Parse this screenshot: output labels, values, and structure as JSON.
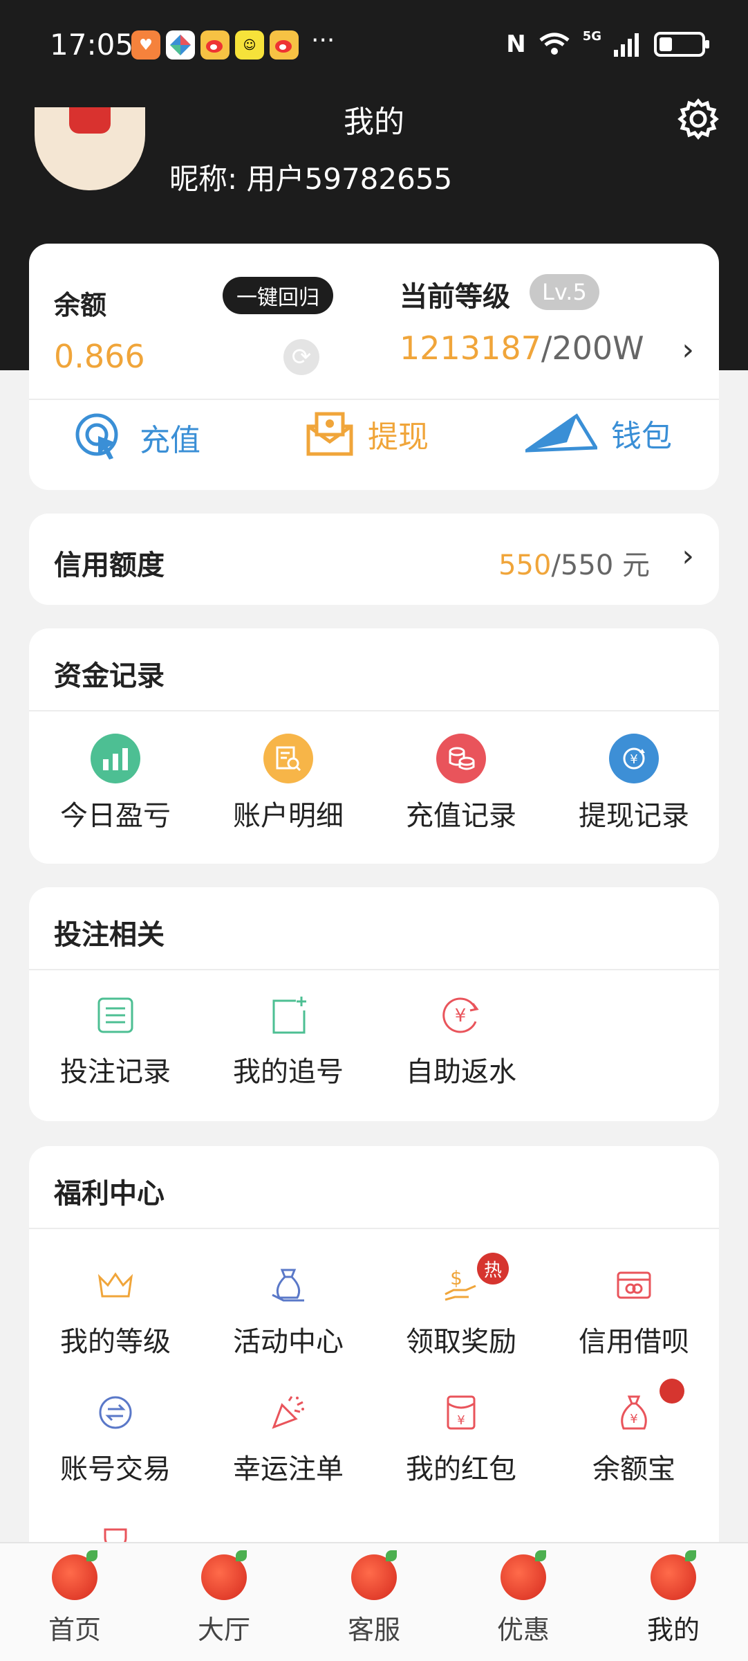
{
  "status_bar": {
    "time": "17:05",
    "more": "···",
    "nfc": "N",
    "network": "5G"
  },
  "header": {
    "title": "我的",
    "nickname": "昵称: 用户59782655"
  },
  "balance": {
    "label": "余额",
    "one_key_label": "一键回归",
    "value": "0.866",
    "level_label": "当前等级",
    "level_badge": "Lv.5",
    "level_current": "1213187",
    "level_target": "/200W"
  },
  "actions": [
    {
      "label": "充值",
      "icon": "recharge-icon",
      "color": "#3a8fd6"
    },
    {
      "label": "提现",
      "icon": "withdraw-icon",
      "color": "#f0a53a"
    },
    {
      "label": "钱包",
      "icon": "wallet-icon",
      "color": "#3a8fd6"
    }
  ],
  "credit": {
    "label": "信用额度",
    "current": "550",
    "total": "/550 元"
  },
  "fund_records": {
    "title": "资金记录",
    "items": [
      {
        "label": "今日盈亏",
        "icon": "chart-icon",
        "color": "#4dbf93"
      },
      {
        "label": "账户明细",
        "icon": "detail-icon",
        "color": "#f7b548"
      },
      {
        "label": "充值记录",
        "icon": "coins-icon",
        "color": "#e9545b"
      },
      {
        "label": "提现记录",
        "icon": "withdraw-record-icon",
        "color": "#3d8fd6"
      }
    ]
  },
  "bet": {
    "title": "投注相关",
    "items": [
      {
        "label": "投注记录",
        "icon": "list-icon",
        "color": "#4dbf93"
      },
      {
        "label": "我的追号",
        "icon": "add-note-icon",
        "color": "#4dbf93"
      },
      {
        "label": "自助返水",
        "icon": "rebate-icon",
        "color": "#e9545b"
      }
    ]
  },
  "welfare": {
    "title": "福利中心",
    "hot": "热",
    "items": [
      {
        "label": "我的等级",
        "icon": "crown-icon",
        "color": "#f0a53a"
      },
      {
        "label": "活动中心",
        "icon": "gift-icon",
        "color": "#5a78c8"
      },
      {
        "label": "领取奖励",
        "icon": "reward-icon",
        "color": "#f0a53a"
      },
      {
        "label": "信用借呗",
        "icon": "card-icon",
        "color": "#e9545b"
      },
      {
        "label": "账号交易",
        "icon": "exchange-icon",
        "color": "#5a78c8"
      },
      {
        "label": "幸运注单",
        "icon": "party-icon",
        "color": "#e9545b"
      },
      {
        "label": "我的红包",
        "icon": "red-packet-icon",
        "color": "#e9545b"
      },
      {
        "label": "余额宝",
        "icon": "money-bag-icon",
        "color": "#e9545b"
      }
    ]
  },
  "bottom_nav": [
    {
      "label": "首页"
    },
    {
      "label": "大厅"
    },
    {
      "label": "客服"
    },
    {
      "label": "优惠"
    },
    {
      "label": "我的"
    }
  ]
}
